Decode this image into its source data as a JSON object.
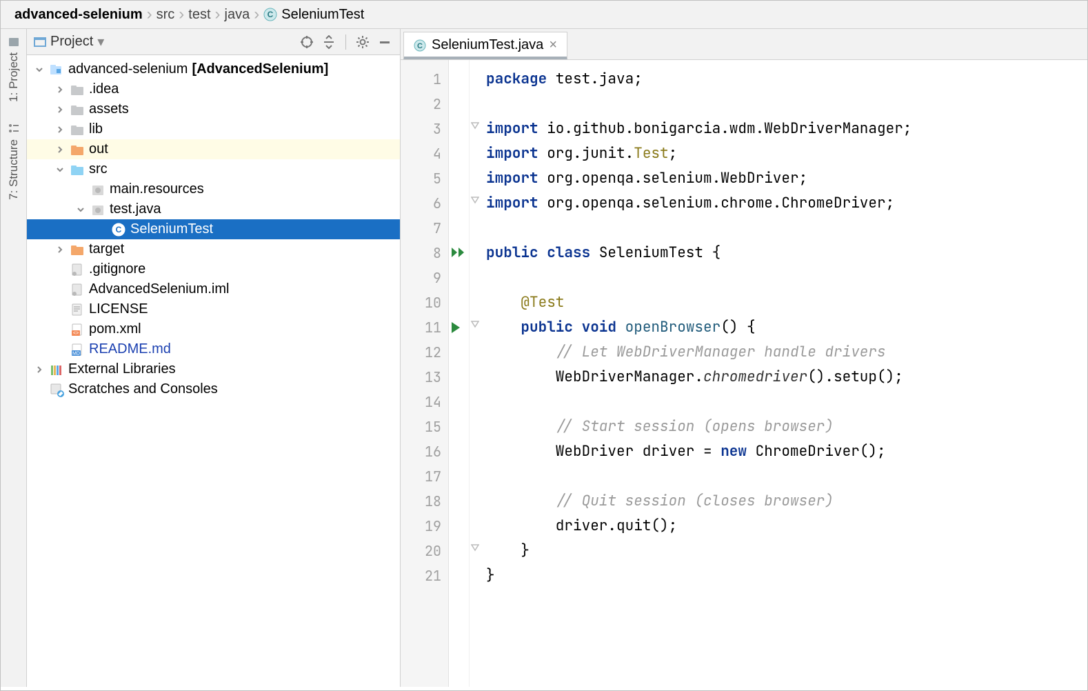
{
  "breadcrumb": [
    "advanced-selenium",
    "src",
    "test",
    "java",
    "SeleniumTest"
  ],
  "left_tools": [
    {
      "label": "1: Project"
    },
    {
      "label": "7: Structure"
    }
  ],
  "project_panel": {
    "title": "Project",
    "tree": [
      {
        "indent": 0,
        "arrow": "down",
        "icon": "module",
        "label": "advanced-selenium",
        "moniker": "[AdvancedSelenium]",
        "bold": true
      },
      {
        "indent": 1,
        "arrow": "right",
        "icon": "folder-gray",
        "label": ".idea"
      },
      {
        "indent": 1,
        "arrow": "right",
        "icon": "folder-gray",
        "label": "assets"
      },
      {
        "indent": 1,
        "arrow": "right",
        "icon": "folder-gray",
        "label": "lib"
      },
      {
        "indent": 1,
        "arrow": "right",
        "icon": "folder-orange",
        "label": "out",
        "hl": "out"
      },
      {
        "indent": 1,
        "arrow": "down",
        "icon": "folder-blue",
        "label": "src"
      },
      {
        "indent": 2,
        "arrow": "none",
        "icon": "pkg",
        "label": "main.resources"
      },
      {
        "indent": 2,
        "arrow": "down",
        "icon": "pkg",
        "label": "test.java"
      },
      {
        "indent": 3,
        "arrow": "none",
        "icon": "class",
        "label": "SeleniumTest",
        "selected": true
      },
      {
        "indent": 1,
        "arrow": "right",
        "icon": "folder-orange",
        "label": "target"
      },
      {
        "indent": 1,
        "arrow": "none",
        "icon": "file",
        "label": ".gitignore"
      },
      {
        "indent": 1,
        "arrow": "none",
        "icon": "file",
        "label": "AdvancedSelenium.iml"
      },
      {
        "indent": 1,
        "arrow": "none",
        "icon": "text",
        "label": "LICENSE"
      },
      {
        "indent": 1,
        "arrow": "none",
        "icon": "xml",
        "label": "pom.xml"
      },
      {
        "indent": 1,
        "arrow": "none",
        "icon": "md",
        "label": "README.md",
        "blue": true
      },
      {
        "indent": 0,
        "arrow": "right",
        "icon": "libs",
        "label": "External Libraries"
      },
      {
        "indent": 0,
        "arrow": "none",
        "icon": "scratch",
        "label": "Scratches and Consoles"
      }
    ]
  },
  "tab": {
    "filename": "SeleniumTest.java"
  },
  "editor": {
    "lines": [
      {
        "n": 1,
        "html": "<span class='kw'>package</span> test.java;"
      },
      {
        "n": 2,
        "html": ""
      },
      {
        "n": 3,
        "html": "<span class='kw'>import</span> io.github.bonigarcia.wdm.WebDriverManager;",
        "fold": true
      },
      {
        "n": 4,
        "html": "<span class='kw'>import</span> org.junit.<span class='ann'>Test</span>;"
      },
      {
        "n": 5,
        "html": "<span class='kw'>import</span> org.openqa.selenium.WebDriver;"
      },
      {
        "n": 6,
        "html": "<span class='kw'>import</span> org.openqa.selenium.chrome.ChromeDriver;",
        "fold": true
      },
      {
        "n": 7,
        "html": ""
      },
      {
        "n": 8,
        "html": "<span class='kw'>public class</span> SeleniumTest {",
        "run": "double"
      },
      {
        "n": 9,
        "html": ""
      },
      {
        "n": 10,
        "html": "    <span class='ann'>@Test</span>"
      },
      {
        "n": 11,
        "html": "    <span class='kw'>public void</span> <span class='fn'>openBrowser</span>() {",
        "run": "single",
        "fold": true
      },
      {
        "n": 12,
        "html": "        <span class='com'>// Let WebDriverManager handle drivers</span>"
      },
      {
        "n": 13,
        "html": "        WebDriverManager.<span class='it'>chromedriver</span>().setup();"
      },
      {
        "n": 14,
        "html": ""
      },
      {
        "n": 15,
        "html": "        <span class='com'>// Start session (opens browser)</span>"
      },
      {
        "n": 16,
        "html": "        WebDriver driver = <span class='kw'>new</span> ChromeDriver();"
      },
      {
        "n": 17,
        "html": ""
      },
      {
        "n": 18,
        "html": "        <span class='com'>// Quit session (closes browser)</span>"
      },
      {
        "n": 19,
        "html": "        driver.quit();"
      },
      {
        "n": 20,
        "html": "    }",
        "fold": true
      },
      {
        "n": 21,
        "html": "}"
      }
    ]
  }
}
